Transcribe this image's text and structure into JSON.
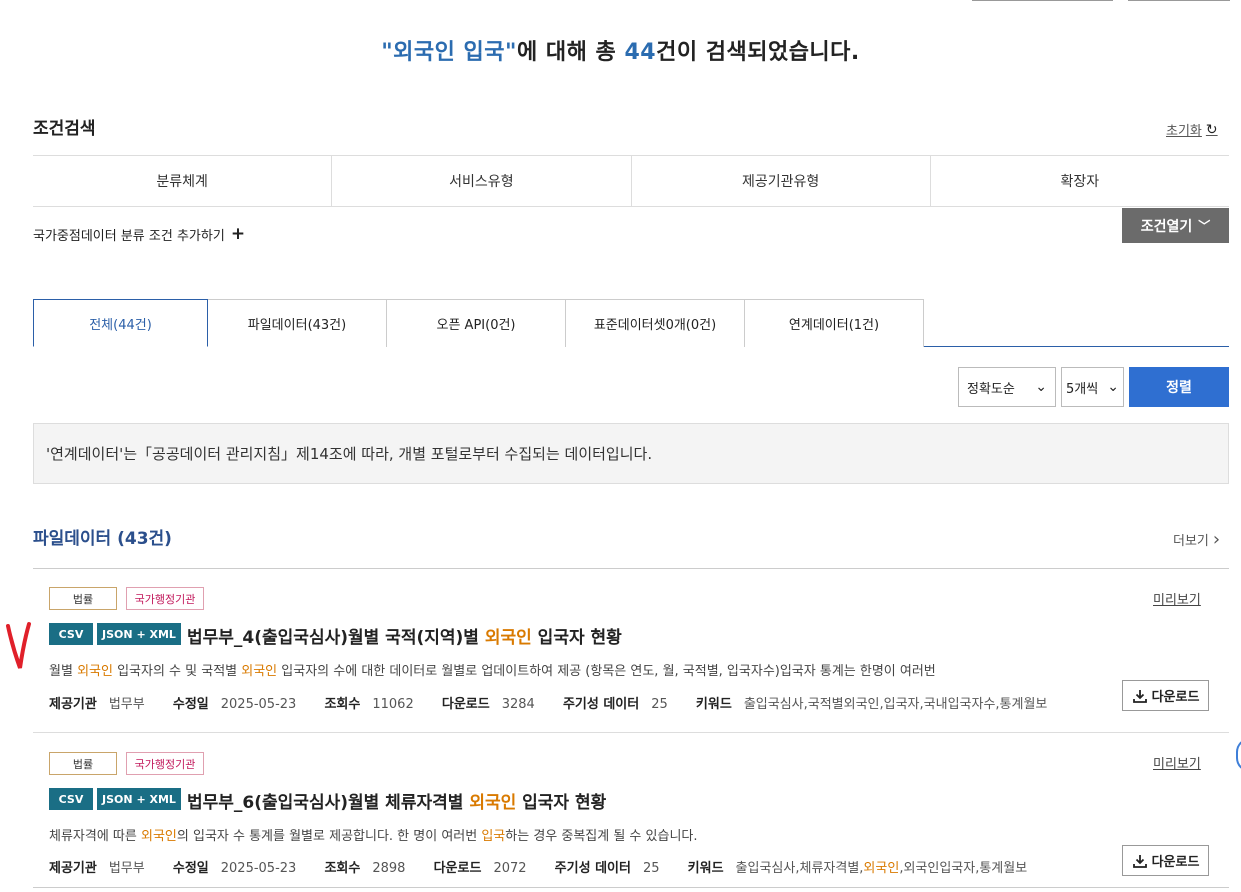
{
  "headline": {
    "quote_open": "\"",
    "keyword": "외국인 입국",
    "quote_close": "\"",
    "mid": "에 대해 총 ",
    "count": "44",
    "tail": "건이 검색되었습니다."
  },
  "condition": {
    "title": "조건검색",
    "reset_label": "초기화",
    "reset_icon": "↻",
    "filters": [
      "분류체계",
      "서비스유형",
      "제공기관유형",
      "확장자"
    ],
    "add_label": "국가중점데이터 분류 조건 추가하기",
    "add_icon": "+",
    "open_label": "조건열기",
    "open_icon": "﹀"
  },
  "tabs": [
    "전체(44건)",
    "파일데이터(43건)",
    "오픈 API(0건)",
    "표준데이터셋0개(0건)",
    "연계데이터(1건)"
  ],
  "sort": {
    "order": "정확도순",
    "per_page": "5개씩",
    "button": "정렬",
    "caret": "⌄"
  },
  "notice": "'연계데이터'는「공공데이터 관리지침」제14조에 따라, 개별 포털로부터 수집되는 데이터입니다.",
  "file_section": {
    "title": "파일데이터 (43건)",
    "more_label": "더보기",
    "more_icon": "›"
  },
  "items": [
    {
      "tags": [
        "법률",
        "국가행정기관"
      ],
      "formats": [
        "CSV",
        "JSON + XML"
      ],
      "title_pre": "법무부_4(출입국심사)월별 국적(지역)별 ",
      "title_hl": "외국인",
      "title_post": " 입국자 현황",
      "preview_label": "미리보기",
      "desc_parts": [
        "월별 ",
        "외국인",
        " 입국자의 수 및 국적별 ",
        "외국인",
        " 입국자의 수에 대한 데이터로 월별로 업데이트하여 제공 (항목은 연도, 월, 국적별, 입국자수)입국자 통계는 한명이 여러번"
      ],
      "meta": {
        "org_label": "제공기관",
        "org": "법무부",
        "date_label": "수정일",
        "date": "2025-05-23",
        "views_label": "조회수",
        "views": "11062",
        "downloads_label": "다운로드",
        "downloads": "3284",
        "periodic_label": "주기성 데이터",
        "periodic": "25",
        "keyword_label": "키워드",
        "keywords_pre": "출입국심사,국적별외국인,입국자,국내입국자수,통계월보",
        "keywords_hl": "",
        "keywords_post": ""
      },
      "download_label": "다운로드"
    },
    {
      "tags": [
        "법률",
        "국가행정기관"
      ],
      "formats": [
        "CSV",
        "JSON + XML"
      ],
      "title_pre": "법무부_6(출입국심사)월별 체류자격별 ",
      "title_hl": "외국인",
      "title_post": " 입국자 현황",
      "preview_label": "미리보기",
      "desc_parts": [
        "체류자격에 따른 ",
        "외국인",
        "의 입국자 수 통계를 월별로 제공합니다. 한 명이 여러번 ",
        "입국",
        "하는 경우 중복집계 될 수 있습니다."
      ],
      "meta": {
        "org_label": "제공기관",
        "org": "법무부",
        "date_label": "수정일",
        "date": "2025-05-23",
        "views_label": "조회수",
        "views": "2898",
        "downloads_label": "다운로드",
        "downloads": "2072",
        "periodic_label": "주기성 데이터",
        "periodic": "25",
        "keyword_label": "키워드",
        "keywords_pre": "출입국심사,체류자격별,",
        "keywords_hl": "외국인",
        "keywords_post": ",외국인입국자,통계월보"
      },
      "download_label": "다운로드"
    }
  ],
  "icons": {
    "download": "download-icon",
    "reset": "refresh-icon",
    "more": "chevron-right-icon",
    "open": "chevron-down-icon"
  },
  "colors": {
    "accent": "#2b6cb0",
    "highlight": "#d97a00",
    "sort_button": "#2f6fd1",
    "open_button": "#6b6b6b",
    "format_badge": "#1a6e85"
  }
}
